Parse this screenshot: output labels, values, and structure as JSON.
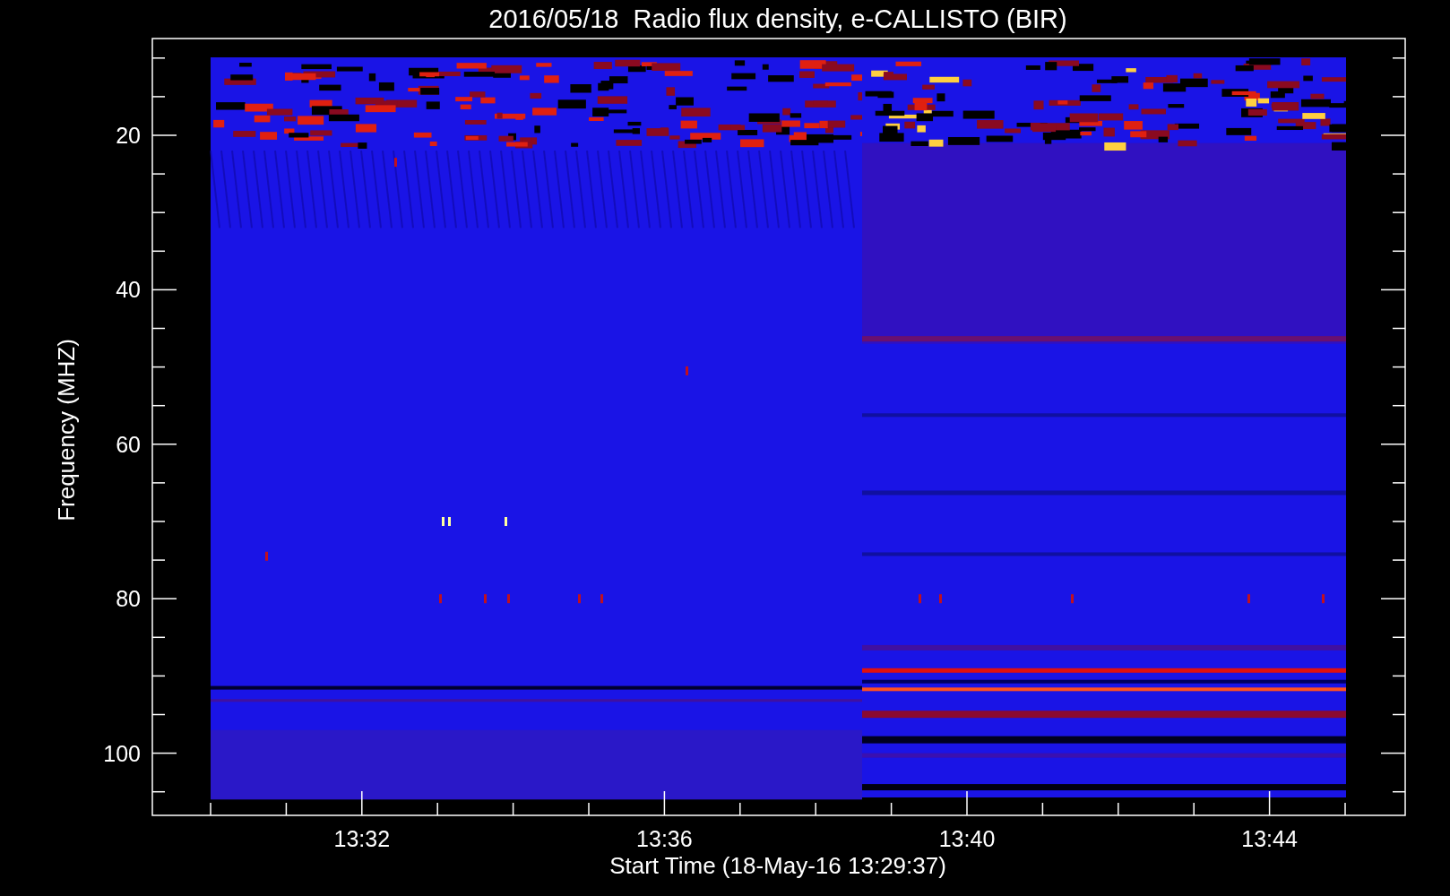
{
  "title": "2016/05/18  Radio flux density, e-CALLISTO (BIR)",
  "y_axis": {
    "label": "Frequency (MHZ)",
    "tick_labels": [
      "20",
      "40",
      "60",
      "80",
      "100"
    ]
  },
  "x_axis": {
    "label": "Start Time (18-May-16 13:29:37)",
    "tick_labels": [
      "13:32",
      "13:36",
      "13:40",
      "13:44"
    ]
  }
}
